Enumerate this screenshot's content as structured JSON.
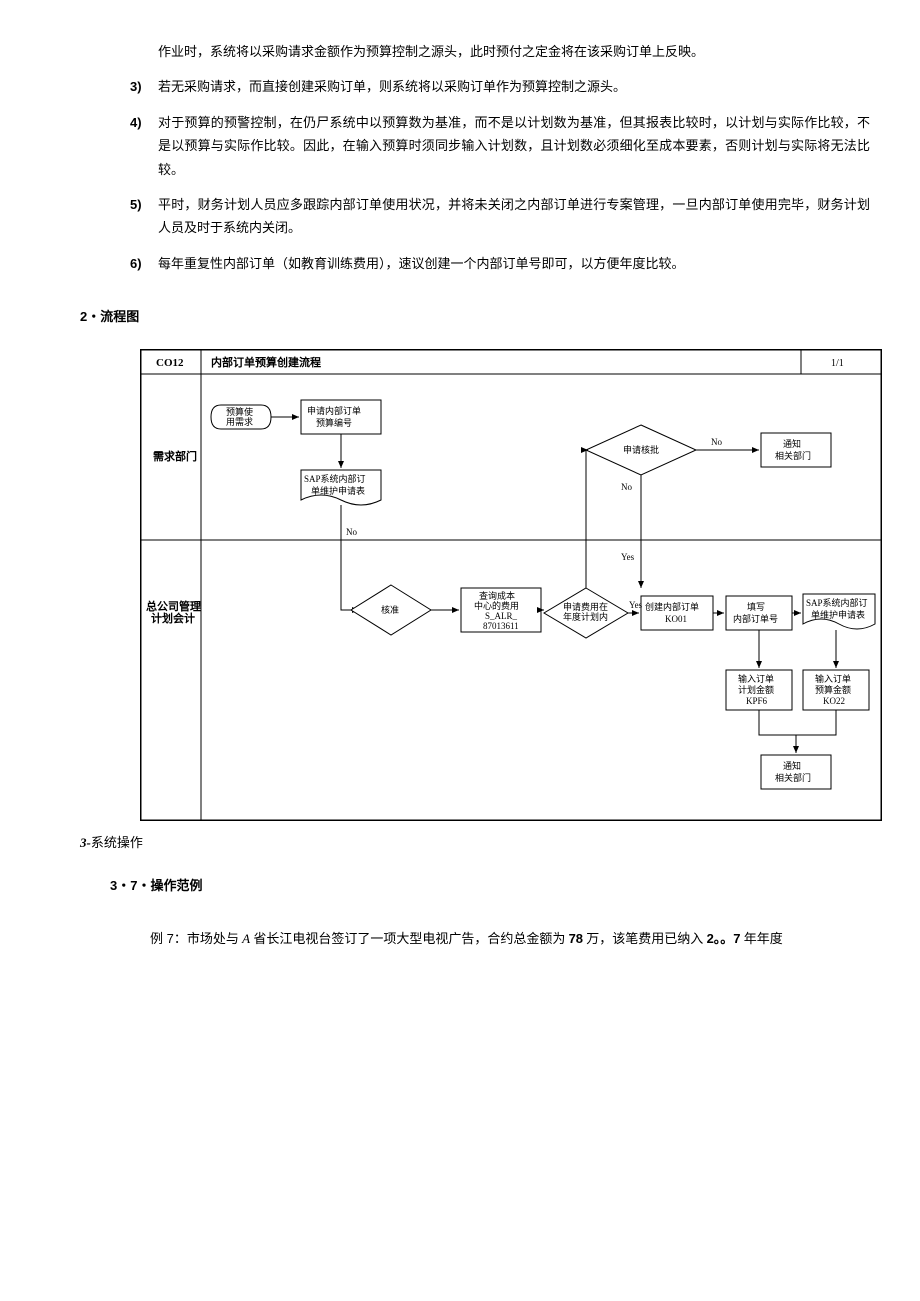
{
  "intro_cont": "作业时，系统将以采购请求金额作为预算控制之源头，此时预付之定金将在该采购订单上反映。",
  "items": {
    "n3": "3)",
    "t3": "若无采购请求，而直接创建采购订单，则系统将以采购订单作为预算控制之源头。",
    "n4": "4)",
    "t4": "对于预算的预警控制，在仍尸系统中以预算数为基准，而不是以计划数为基准，但其报表比较时，以计划与实际作比较，不是以预算与实际作比较。因此，在输入预算时须同步输入计划数，且计划数必须细化至成本要素，否则计划与实际将无法比较。",
    "n5": "5)",
    "t5": "平时，财务计划人员应多跟踪内部订单使用状况，并将未关闭之内部订单进行专案管理，一旦内部订单使用完毕，财务计划人员及时于系统内关闭。",
    "n6": "6)",
    "t6": "每年重复性内部订单（如教育训练费用），速议创建一个内部订单号即可，以方便年度比较。"
  },
  "sec2_num": "2・",
  "sec2_title": "流程图",
  "sec3_num": "3-",
  "sec3_title": "系统操作",
  "sec31_num": "3・7・",
  "sec31_title": "操作范例",
  "example_label": "例 7：",
  "example_text_a": "市场处与 ",
  "example_text_a2": "A",
  "example_text_b": " 省长江电视台签订了一项大型电视广告，合约总金额为 ",
  "example_text_c": "78",
  "example_text_d": " 万，该笔费用已纳入 ",
  "example_text_e": "2。。7",
  "example_text_f": " 年年度",
  "flow": {
    "code": "CO12",
    "title": "内部订单预算创建流程",
    "page": "1/1",
    "lane1": "需求部门",
    "lane2": "总公司管理",
    "lane2b": "计划会计",
    "n_start": "预算使",
    "n_start2": "用需求",
    "n_apply1": "申请内部订单",
    "n_apply2": "预算编号",
    "n_form1": "SAP系统内部订",
    "n_form2": "单维护申请表",
    "n_approve": "申请核批",
    "n_notify1": "通知",
    "n_notify2": "相关部门",
    "n_check": "核准",
    "n_query1": "查询成本",
    "n_query2": "中心的费用",
    "n_query3": "S_ALR_",
    "n_query4": "87013611",
    "n_inplan1": "申请费用在",
    "n_inplan2": "年度计划内",
    "n_create1": "创建内部订单",
    "n_create2": "KO01",
    "n_fill1": "填写",
    "n_fill2": "内部订单号",
    "n_form_r1": "SAP系统内部订",
    "n_form_r2": "单维护申请表",
    "n_plan1": "输入订单",
    "n_plan2": "计划金额",
    "n_plan3": "KPF6",
    "n_bud1": "输入订单",
    "n_bud2": "预算金额",
    "n_bud3": "KO22",
    "n_notify_b1": "通知",
    "n_notify_b2": "相关部门",
    "lbl_no": "No",
    "lbl_yes": "Yes"
  }
}
